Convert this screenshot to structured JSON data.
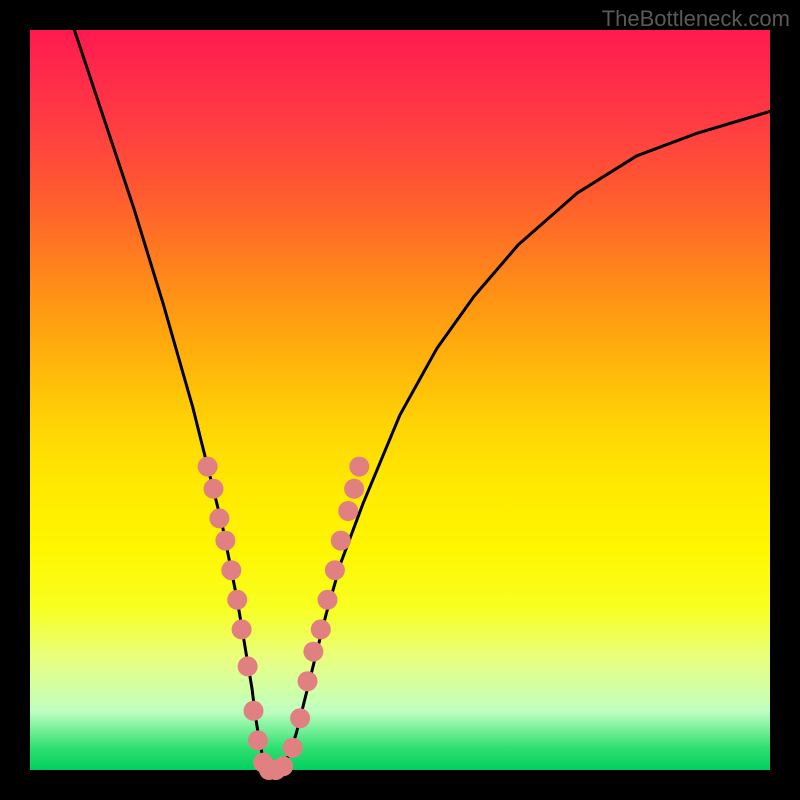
{
  "watermark": "TheBottleneck.com",
  "chart_data": {
    "type": "line",
    "title": "",
    "xlabel": "",
    "ylabel": "",
    "xlim": [
      0,
      100
    ],
    "ylim": [
      0,
      100
    ],
    "series": [
      {
        "name": "curve",
        "x": [
          6,
          10,
          14,
          18,
          20,
          22,
          24,
          25,
          26,
          27,
          28,
          29,
          30,
          30.5,
          31,
          31.5,
          32,
          33,
          34,
          35,
          36,
          37,
          38,
          39,
          40,
          42,
          45,
          50,
          55,
          60,
          66,
          74,
          82,
          90,
          100
        ],
        "y": [
          100,
          88,
          76,
          63,
          56,
          49,
          41,
          37,
          33,
          28,
          23,
          17,
          11,
          7,
          4,
          1.5,
          0,
          0,
          0.5,
          2,
          5,
          9,
          13,
          17,
          21,
          28,
          36,
          48,
          57,
          64,
          71,
          78,
          83,
          86,
          89
        ]
      }
    ],
    "markers": {
      "name": "highlight-points",
      "color": "#e08080",
      "points": [
        {
          "x": 24.0,
          "y": 41
        },
        {
          "x": 24.8,
          "y": 38
        },
        {
          "x": 25.6,
          "y": 34
        },
        {
          "x": 26.4,
          "y": 31
        },
        {
          "x": 27.2,
          "y": 27
        },
        {
          "x": 28.0,
          "y": 23
        },
        {
          "x": 28.6,
          "y": 19
        },
        {
          "x": 29.4,
          "y": 14
        },
        {
          "x": 30.2,
          "y": 8
        },
        {
          "x": 30.8,
          "y": 4
        },
        {
          "x": 31.5,
          "y": 1
        },
        {
          "x": 32.3,
          "y": 0
        },
        {
          "x": 33.2,
          "y": 0
        },
        {
          "x": 34.2,
          "y": 0.5
        },
        {
          "x": 35.5,
          "y": 3
        },
        {
          "x": 36.5,
          "y": 7
        },
        {
          "x": 37.5,
          "y": 12
        },
        {
          "x": 38.3,
          "y": 16
        },
        {
          "x": 39.3,
          "y": 19
        },
        {
          "x": 40.2,
          "y": 23
        },
        {
          "x": 41.2,
          "y": 27
        },
        {
          "x": 42.0,
          "y": 31
        },
        {
          "x": 43.0,
          "y": 35
        },
        {
          "x": 43.8,
          "y": 38
        },
        {
          "x": 44.5,
          "y": 41
        }
      ]
    }
  }
}
